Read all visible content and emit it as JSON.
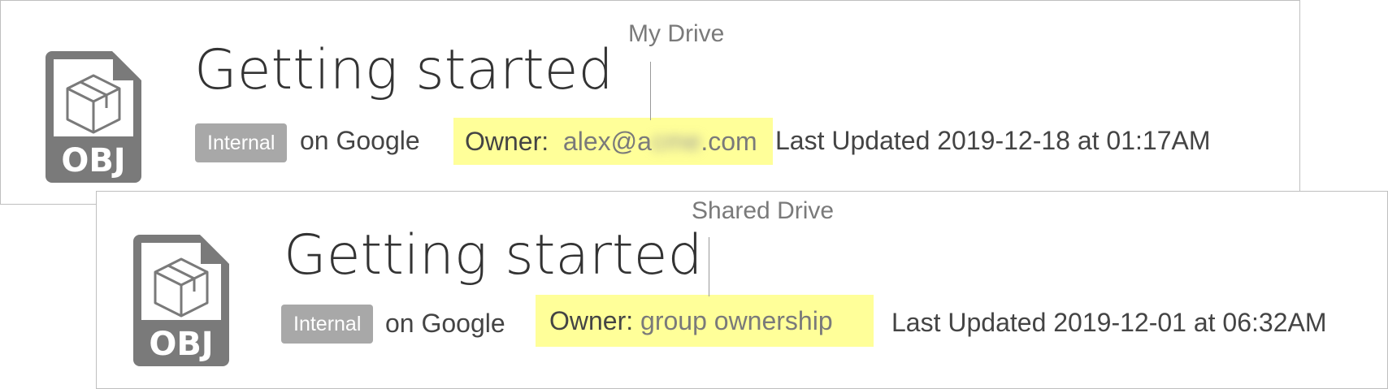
{
  "cards": [
    {
      "title": "Getting started",
      "file_type": "OBJ",
      "badge": "Internal",
      "location_text": "on Google",
      "owner_label": "Owner:",
      "owner_value_start": "alex@a",
      "owner_value_obscured": "cme",
      "owner_value_end": ".com",
      "last_updated": "Last Updated 2019-12-18 at 01:17AM",
      "callout": "My Drive"
    },
    {
      "title": "Getting started",
      "file_type": "OBJ",
      "badge": "Internal",
      "location_text": "on Google",
      "owner_label": "Owner:",
      "owner_value": "group ownership",
      "last_updated": "Last Updated 2019-12-01 at 06:32AM",
      "callout": "Shared Drive"
    }
  ],
  "colors": {
    "highlight": "#ffff99",
    "badge_bg": "#a8a8a8",
    "icon_gray": "#7a7a7a",
    "border": "#bfbfbf"
  },
  "icons": [
    "file-obj-icon",
    "cube-icon"
  ]
}
